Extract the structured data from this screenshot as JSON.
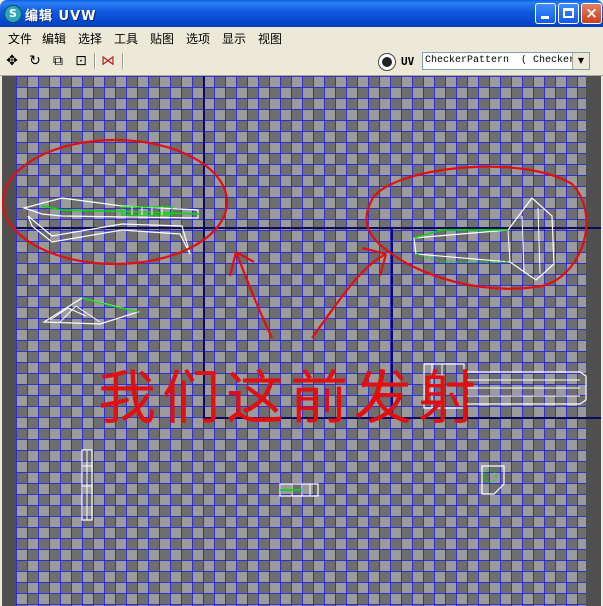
{
  "window": {
    "title": "编辑 UVW",
    "icon": "app-logo-icon",
    "controls": [
      "minimize-icon",
      "maximize-icon",
      "close-icon"
    ]
  },
  "menu": {
    "items": [
      "文件",
      "编辑",
      "选择",
      "工具",
      "贴图",
      "选项",
      "显示",
      "视图"
    ]
  },
  "toolbar": {
    "tools": [
      "move-icon",
      "rotate-icon",
      "scale-icon",
      "freeform-icon",
      "mirror-icon"
    ],
    "uv_label": "UV",
    "texture_select": "CheckerPattern  ( Checker",
    "colors": {
      "highlight": "#6b8dd6"
    }
  },
  "viewport": {
    "annotation_text": "我们这前发射",
    "colors": {
      "grid": "#2828dc",
      "uv_edges": "#ffffff",
      "selected_edges": "#00dd00",
      "annotation": "#e01010",
      "tile_border": "#0a0a60"
    }
  }
}
